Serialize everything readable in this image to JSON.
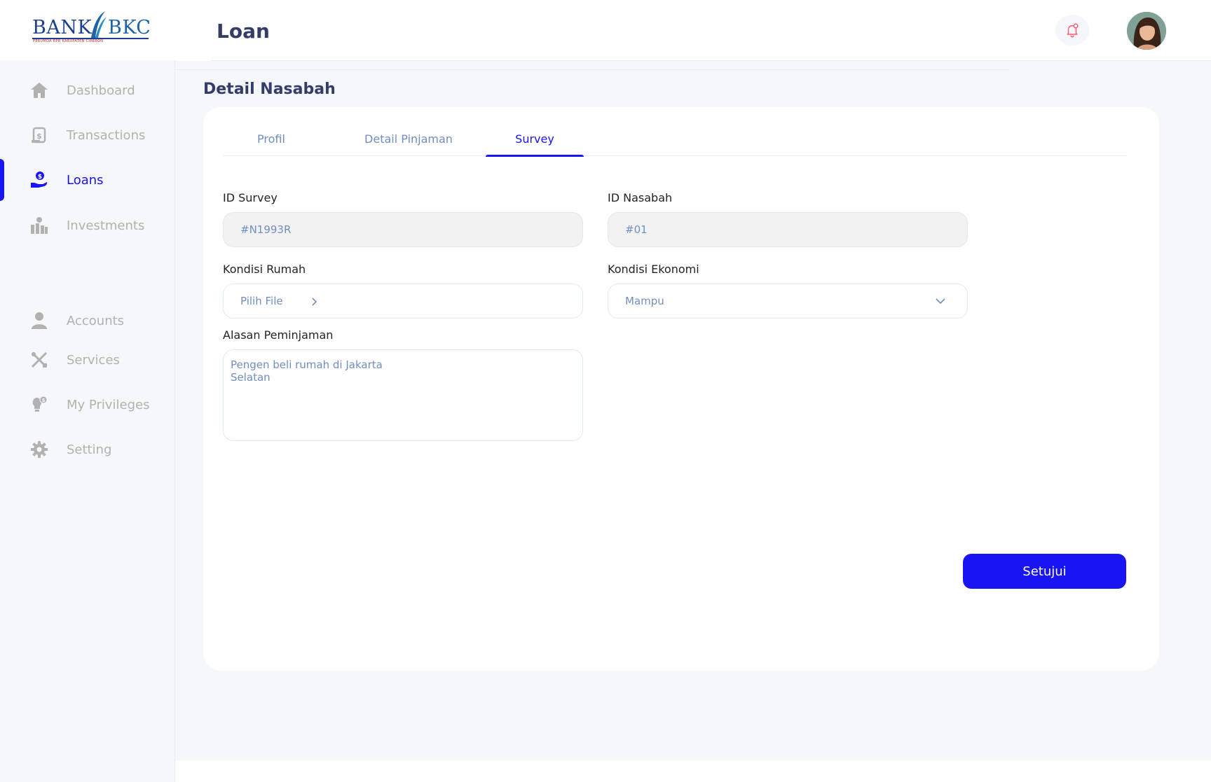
{
  "header": {
    "logo_left": "BANK",
    "logo_right": "BKC",
    "logo_sub": "PERUMDA BPR KABUPATEN CIREBON",
    "page_title": "Loan",
    "bell_icon": "bell-icon",
    "avatar_icon": "avatar"
  },
  "sidebar": {
    "items": [
      {
        "label": "Dashboard",
        "icon": "home-icon",
        "active": false
      },
      {
        "label": "Transactions",
        "icon": "transfer-icon",
        "active": false
      },
      {
        "label": "Loans",
        "icon": "loan-icon",
        "active": true
      },
      {
        "label": "Investments",
        "icon": "investment-icon",
        "active": false
      },
      {
        "label": "Accounts",
        "icon": "user-icon",
        "active": false
      },
      {
        "label": "Services",
        "icon": "services-icon",
        "active": false
      },
      {
        "label": "My Privileges",
        "icon": "privileges-icon",
        "active": false
      },
      {
        "label": "Setting",
        "icon": "gear-icon",
        "active": false
      }
    ]
  },
  "main": {
    "section_title": "Detail Nasabah",
    "tabs": [
      {
        "label": "Profil",
        "active": false
      },
      {
        "label": "Detail Pinjaman",
        "active": false
      },
      {
        "label": "Survey",
        "active": true
      }
    ],
    "form": {
      "id_survey": {
        "label": "ID Survey",
        "value": "#N1993R"
      },
      "id_nasabah": {
        "label": "ID Nasabah",
        "value": "#01"
      },
      "kondisi_rumah": {
        "label": "Kondisi Rumah",
        "value": "Pilih File"
      },
      "kondisi_ekonomi": {
        "label": "Kondisi Ekonomi",
        "value": "Mampu"
      },
      "alasan": {
        "label": "Alasan Peminjaman",
        "value": "Pengen beli rumah di Jakarta\nSelatan"
      }
    },
    "submit_label": "Setujui"
  },
  "colors": {
    "accent": "#1814f3",
    "muted": "#b1b1b1",
    "title": "#343c6a",
    "field_text": "#718ebf",
    "sidebar_bg": "#f5f7fa"
  }
}
